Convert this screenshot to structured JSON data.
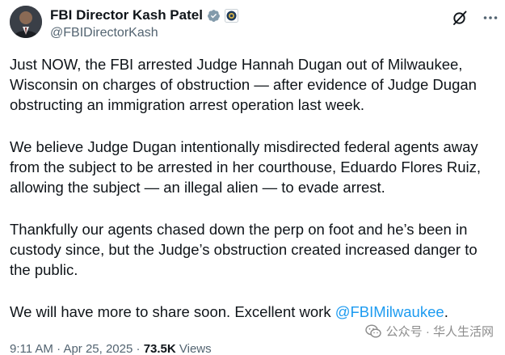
{
  "author": {
    "display_name": "FBI Director Kash Patel",
    "handle": "@FBIDirectorKash",
    "avatar_icon": "avatar",
    "verified_icon": "verified-badge-icon",
    "gov_icon": "government-badge-icon"
  },
  "actions": {
    "grok_icon": "grok-icon",
    "more_icon": "more-icon"
  },
  "tweet": {
    "paragraph_1": "Just NOW, the FBI arrested Judge Hannah Dugan out of Milwaukee, Wisconsin on charges of obstruction — after evidence of Judge Dugan obstructing an immigration arrest operation last week.",
    "paragraph_2": "We believe Judge Dugan intentionally misdirected federal agents away from the subject to be arrested in her courthouse, Eduardo Flores Ruiz, allowing the subject — an illegal alien — to evade arrest.",
    "paragraph_3": "Thankfully our agents chased down the perp on foot and he’s been in custody since, but the Judge’s obstruction created increased danger to the public.",
    "paragraph_4_text": "We will have more to share soon. Excellent work ",
    "paragraph_4_mention": "@FBIMilwaukee",
    "paragraph_4_end": "."
  },
  "meta": {
    "time": "9:11 AM",
    "sep1": " · ",
    "date": "Apr 25, 2025",
    "sep2": " · ",
    "views_count": "73.5K",
    "views_label": " Views"
  },
  "watermark": {
    "text": "公众号 · 华人生活网",
    "icon": "wechat-icon"
  },
  "colors": {
    "accent": "#1d9bf0",
    "text": "#0f1419",
    "muted": "#536471"
  }
}
